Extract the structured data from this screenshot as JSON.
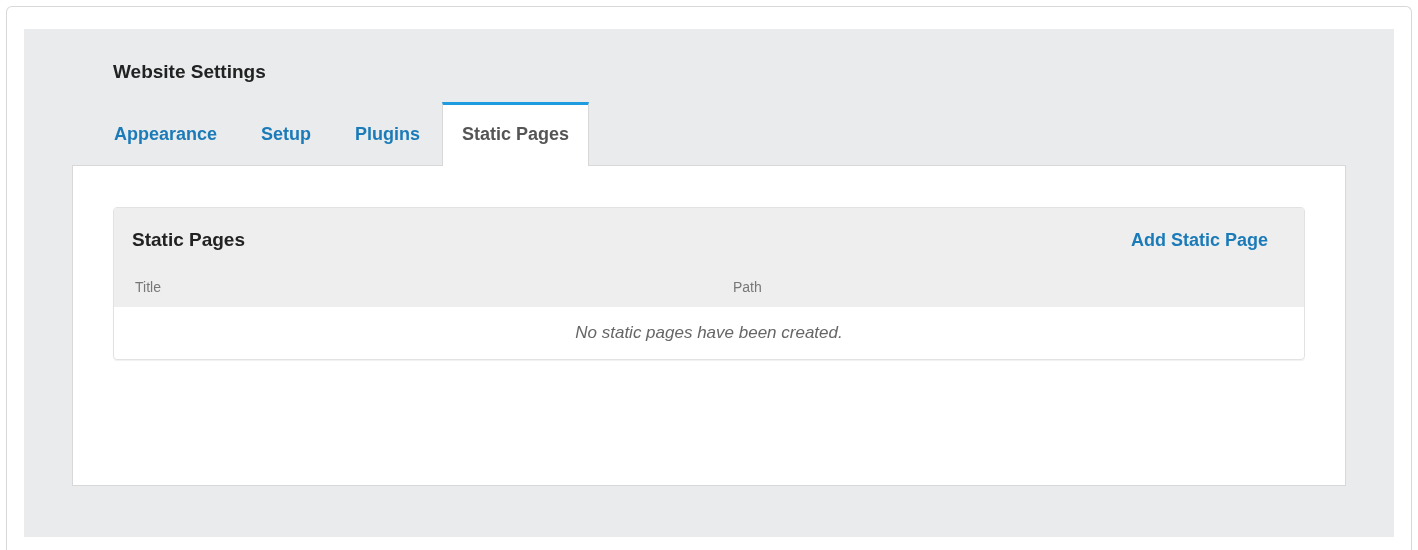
{
  "page_title": "Website Settings",
  "tabs": [
    {
      "label": "Appearance",
      "selected": false
    },
    {
      "label": "Setup",
      "selected": false
    },
    {
      "label": "Plugins",
      "selected": false
    },
    {
      "label": "Static Pages",
      "selected": true
    }
  ],
  "grid": {
    "title": "Static Pages",
    "action": "Add Static Page",
    "columns": [
      "Title",
      "Path"
    ],
    "empty_message": "No static pages have been created."
  }
}
